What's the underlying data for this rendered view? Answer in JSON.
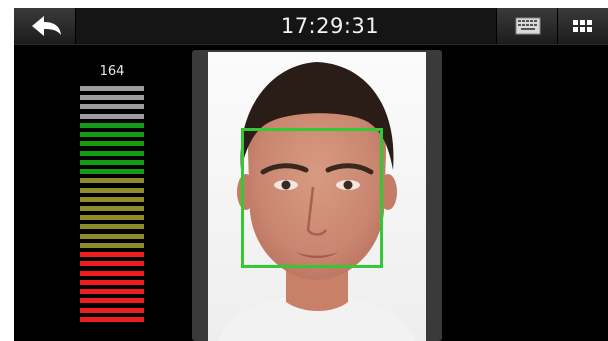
{
  "topbar": {
    "time": "17:29:31",
    "back_icon": "back-arrow-icon",
    "keyboard_icon": "keyboard-icon",
    "menu_icon": "grid-menu-icon"
  },
  "match": {
    "score": "164",
    "level_segments": 26,
    "colors": {
      "gray": "#9c9c9c",
      "green": "#169a16",
      "olive": "#8e8b28",
      "red": "#ee1c1c"
    },
    "segments_by_color": {
      "gray": 4,
      "green": 6,
      "olive": 8,
      "red": 8
    }
  },
  "camera": {
    "face_box_color": "#34c934"
  }
}
